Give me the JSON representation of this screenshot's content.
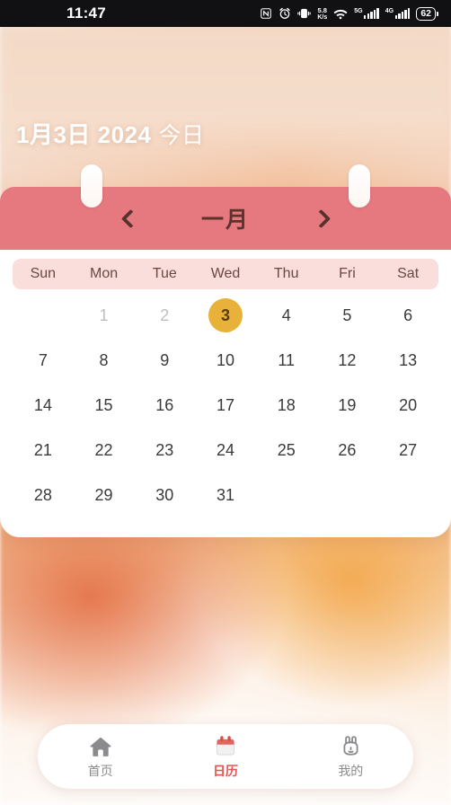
{
  "statusbar": {
    "time": "11:47",
    "icons": [
      {
        "name": "nfc-icon",
        "label": "NFC"
      },
      {
        "name": "alarm-icon",
        "label": "Alarm"
      },
      {
        "name": "vibrate-icon",
        "label": "Vibrate"
      }
    ],
    "network_speed": {
      "value": "5.8",
      "unit": "K/s"
    },
    "wifi": "wifi-icon",
    "signal_1_label": "5G",
    "signal_2_label": "4G",
    "battery_level": "62"
  },
  "header": {
    "date": "1月3日 2024",
    "today_label": "今日"
  },
  "calendar": {
    "prev_label": "‹",
    "next_label": "›",
    "month_title": "一月",
    "weekdays": [
      "Sun",
      "Mon",
      "Tue",
      "Wed",
      "Thu",
      "Fri",
      "Sat"
    ],
    "leading_blanks": 1,
    "muted_days": [
      1,
      2
    ],
    "selected_day": 3,
    "days": [
      [
        "",
        "1",
        "2",
        "3",
        "4",
        "5",
        "6"
      ],
      [
        "7",
        "8",
        "9",
        "10",
        "11",
        "12",
        "13"
      ],
      [
        "14",
        "15",
        "16",
        "17",
        "18",
        "19",
        "20"
      ],
      [
        "21",
        "22",
        "23",
        "24",
        "25",
        "26",
        "27"
      ],
      [
        "28",
        "29",
        "30",
        "31",
        "",
        "",
        ""
      ]
    ],
    "accent_selected_bg": "#e8b13a",
    "month_bar_bg": "#e5797f",
    "weekbar_bg": "#fadedb"
  },
  "tabbar": {
    "items": [
      {
        "icon": "home-icon",
        "label": "首页",
        "active": false
      },
      {
        "icon": "calendar-icon",
        "label": "日历",
        "active": true
      },
      {
        "icon": "rabbit-icon",
        "label": "我的",
        "active": false
      }
    ],
    "active_color": "#e2544f",
    "inactive_color": "#8b8b8e"
  }
}
